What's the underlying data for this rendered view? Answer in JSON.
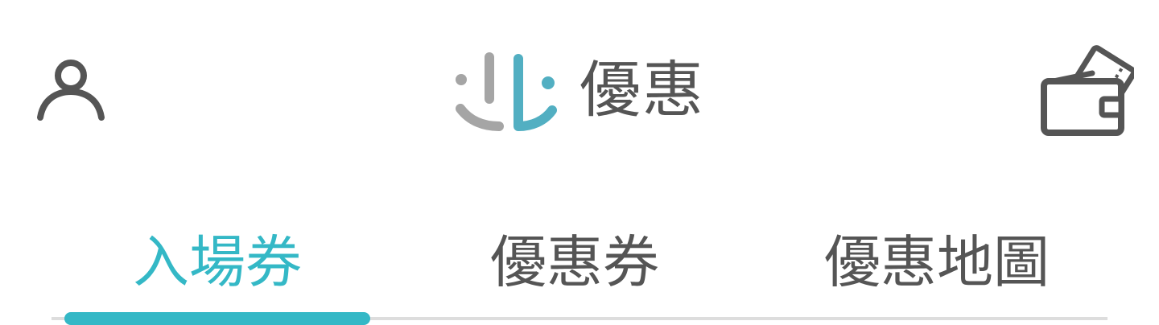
{
  "header": {
    "title": "優惠",
    "profile_icon": "user-icon",
    "wallet_icon": "ticket-wallet-icon",
    "logo_icon": "brand-logo-icon",
    "accent_color": "#34b8c6",
    "logo_gray": "#a5a5a5",
    "text_color": "#555555"
  },
  "tabs": [
    {
      "label": "入場券",
      "active": true
    },
    {
      "label": "優惠券",
      "active": false
    },
    {
      "label": "優惠地圖",
      "active": false
    }
  ]
}
